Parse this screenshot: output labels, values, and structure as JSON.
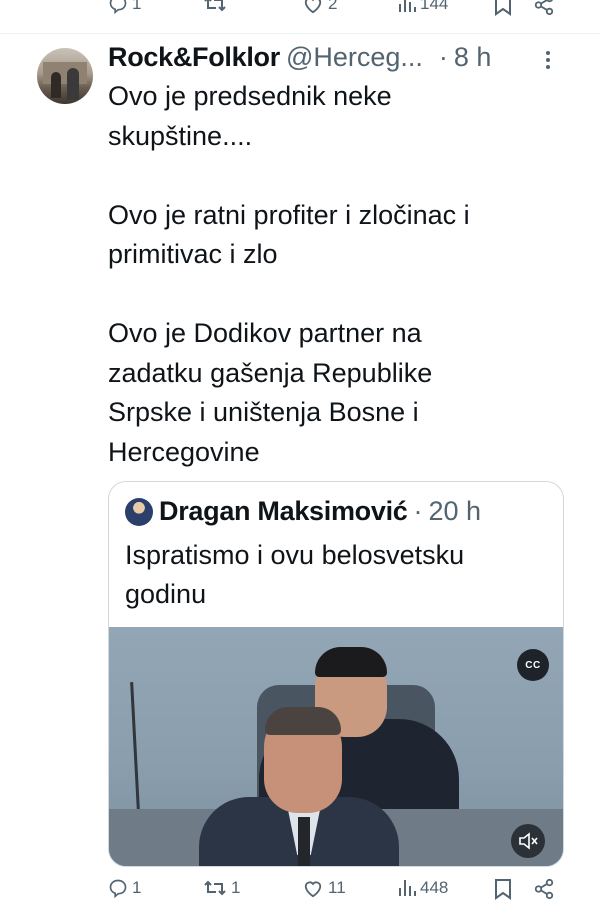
{
  "prev_actions": {
    "replies": "1",
    "reposts": "",
    "likes": "2",
    "views": "144"
  },
  "tweet": {
    "display_name": "Rock&Folklor",
    "handle": "@Herceg...",
    "dot": "·",
    "time": "8 h",
    "text": "Ovo je predsednik neke\nskupštine....\n\nOvo je ratni profiter i zločinac i\nprimitivac i zlo\n\nOvo je Dodikov partner na\nzadatku gašenja Republike\nSrpske i uništenja Bosne i\nHercegovine"
  },
  "quote": {
    "display_name": "Dragan Maksimović",
    "dot": "·",
    "time": "20 h",
    "text": "Ispratismo i ovu belosvetsku godinu",
    "video": {
      "cc_label": "CC"
    }
  },
  "actions": {
    "replies": "1",
    "reposts": "1",
    "likes": "11",
    "views": "448"
  },
  "colors": {
    "secondary_text": "#536471",
    "border": "#cfd9de"
  },
  "icons": [
    "reply-icon",
    "repost-icon",
    "like-icon",
    "views-icon",
    "bookmark-icon",
    "share-icon",
    "more-icon",
    "cc-icon",
    "mute-icon"
  ]
}
